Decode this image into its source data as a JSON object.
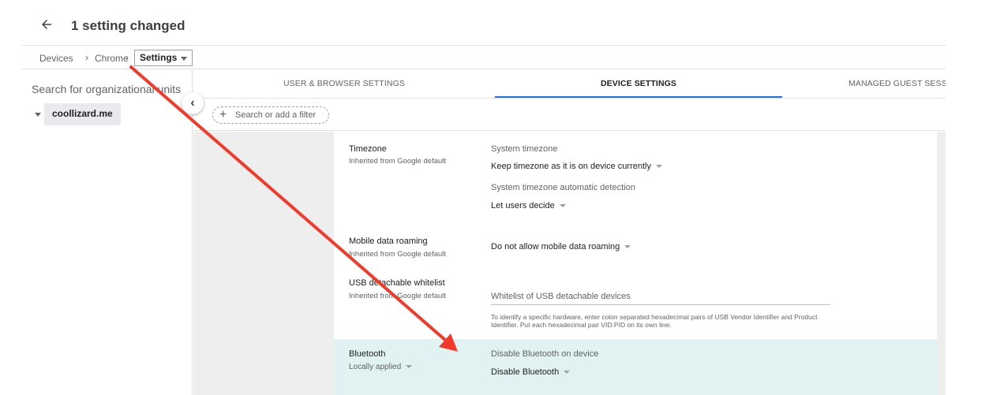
{
  "header": {
    "title": "1 setting changed"
  },
  "breadcrumb": {
    "items": [
      "Devices",
      "Chrome",
      "Settings"
    ],
    "sep": "›"
  },
  "sidebar": {
    "search_placeholder": "Search for organizational units",
    "org_unit": "coollizard.me"
  },
  "tabs": [
    {
      "label": "USER & BROWSER SETTINGS"
    },
    {
      "label": "DEVICE SETTINGS"
    },
    {
      "label": "MANAGED GUEST SESSI"
    }
  ],
  "filter": {
    "placeholder": "Search or add a filter"
  },
  "settings": {
    "timezone": {
      "title": "Timezone",
      "sub": "Inherited from Google default",
      "field1_label": "System timezone",
      "field1_value": "Keep timezone as it is on device currently",
      "field2_label": "System timezone automatic detection",
      "field2_value": "Let users decide"
    },
    "roaming": {
      "title": "Mobile data roaming",
      "sub": "Inherited from Google default",
      "value": "Do not allow mobile data roaming"
    },
    "usb": {
      "title": "USB detachable whitelist",
      "sub": "Inherited from Google default",
      "field_placeholder": "Whitelist of USB detachable devices",
      "help": "To identify a specific hardware, enter colon separated hexadecimal pairs of USB Vendor Identifier and Product Identifier. Put each hexadecimal pair VID:PID on its own line."
    },
    "bluetooth": {
      "title": "Bluetooth",
      "sub": "Locally applied",
      "field_label": "Disable Bluetooth on device",
      "value": "Disable Bluetooth"
    }
  },
  "colors": {
    "accent": "#1a73e8",
    "highlight_row": "#e0f2f1",
    "annotation_arrow": "#f03a2a"
  }
}
